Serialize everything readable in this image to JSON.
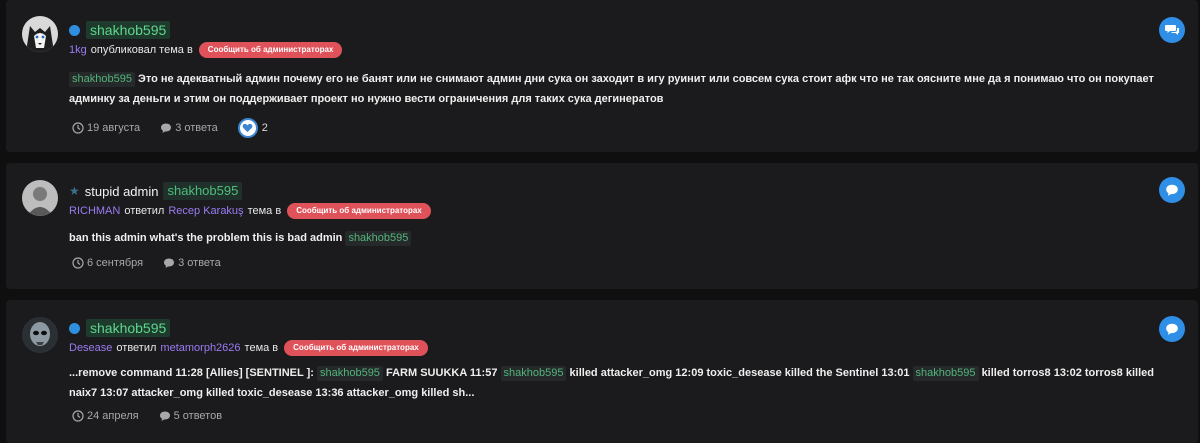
{
  "report_label": "Сообщить об администраторах",
  "posts": [
    {
      "username": "shakhob595",
      "actor": "1kg",
      "action": "опубликовал тема в",
      "mention": "shakhob595",
      "body": "Это не адекватный админ почему его не банят или не снимают админ дни сука он заходит в игу руинит или совсем сука стоит афк что не так оясните мне да я понимаю что он покупает админку за деньги и этим он поддерживает проект но нужно вести ограничения для таких сука дегинератов",
      "date": "19 августа",
      "replies": "3 ответа",
      "likes": "2"
    },
    {
      "username_plain": "stupid admin",
      "username": "shakhob595",
      "actor": "RICHMAN",
      "action_mid": "ответил",
      "target": "Recep Karakuş",
      "action": "тема в",
      "body": "ban this admin what's the problem this is bad admin",
      "mention": "shakhob595",
      "date": "6 сентября",
      "replies": "3 ответа"
    },
    {
      "username": "shakhob595",
      "actor": "Desease",
      "action_mid": "ответил",
      "target": "metamorph2626",
      "action": "тема в",
      "body_a": "...remove command 11:28 [Allies] [SENTINEL ]:",
      "mention": "shakhob595",
      "body_b": "FARM SUUKKA 11:57",
      "body_c": "killed attacker_omg 12:09 toxic_desease killed the Sentinel 13:01",
      "body_d": "killed torros8 13:02 torros8 killed naix7 13:07 attacker_omg killed toxic_desease 13:36 attacker_omg killed sh...",
      "date": "24 апреля",
      "replies": "5 ответов"
    }
  ],
  "colors": {
    "accent_blue": "#2f8ee5",
    "report_red": "#e0525a",
    "username_green": "#5fd68c",
    "link_purple": "#9b7cf4"
  }
}
